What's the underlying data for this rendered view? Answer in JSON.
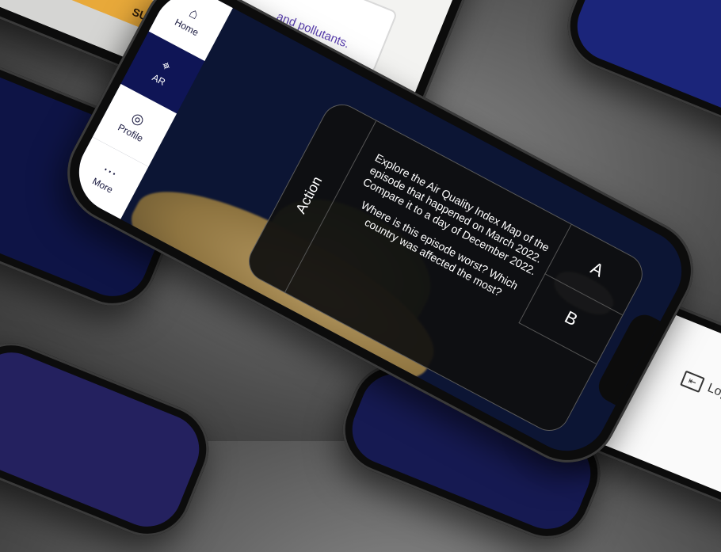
{
  "form_phone": {
    "field_text": "and pollutants.",
    "submit_label": "SUBMIT"
  },
  "left_phone": {
    "glyph": "+"
  },
  "logout_phone": {
    "logout_label": "Logo"
  },
  "quiz": {
    "option_a": "A",
    "option_b": "B",
    "question_intro": "Explore the Air Quality Index Map of the episode that happened on March 2022. Compare it to a day of December 2022.",
    "question_followup": "Where is this episode worst? Which country was affected the most?",
    "action_label": "Action"
  },
  "bottom_nav": {
    "items": [
      {
        "label": "Home",
        "icon": "home-icon",
        "active": false
      },
      {
        "label": "AR",
        "icon": "ar-icon",
        "active": true
      },
      {
        "label": "Profile",
        "icon": "profile-icon",
        "active": false
      },
      {
        "label": "More",
        "icon": "more-icon",
        "active": false
      }
    ]
  },
  "colors": {
    "submit_button": "#e8a93a",
    "nav_active": "#0f1556",
    "quiz_panel": "#0f0f0f",
    "accent_plus": "#7fdfcf"
  }
}
